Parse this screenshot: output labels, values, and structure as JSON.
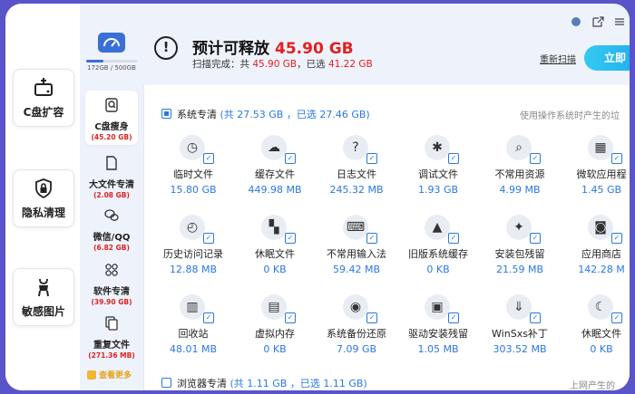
{
  "promo": [
    {
      "label": "C盘扩容",
      "icon": "hard-drive-plus-icon"
    },
    {
      "label": "隐私清理",
      "icon": "lock-icon"
    },
    {
      "label": "敏感图片",
      "icon": "figure-image-icon"
    }
  ],
  "disk": {
    "usage": "172GB / 500GB",
    "fill_fraction": 0.34
  },
  "nav": [
    {
      "name": "C盘瘦身",
      "size": "(45.20 GB)",
      "icon": "search-doc-icon"
    },
    {
      "name": "大文件专清",
      "size": "(2.08 GB)",
      "icon": "file-icon"
    },
    {
      "name": "微信/QQ",
      "size": "(6.82 GB)",
      "icon": "chat-icon"
    },
    {
      "name": "软件专清",
      "size": "(39.90 GB)",
      "icon": "apps-icon"
    },
    {
      "name": "重复文件",
      "size": "(271.36 MB)",
      "icon": "duplicate-icon"
    }
  ],
  "more_label": "查看更多",
  "header": {
    "title": "预计可释放",
    "amount": "45.90 GB",
    "sub_prefix": "扫描完成：共",
    "sub_total": "45.90 GB",
    "sub_mid": "，已选",
    "sub_selected": "41.22 GB",
    "rescan": "重新扫描",
    "cta": "立即"
  },
  "section1": {
    "title": "系统专清",
    "count": "(共 27.53 GB ，已选 27.46 GB)",
    "hint": "使用操作系统时产生的垃"
  },
  "items": [
    {
      "name": "临时文件",
      "size": "15.80 GB",
      "icon": "clipboard-clock-icon"
    },
    {
      "name": "缓存文件",
      "size": "449.98 MB",
      "icon": "cloud-download-icon"
    },
    {
      "name": "日志文件",
      "size": "245.32 MB",
      "icon": "log-question-icon"
    },
    {
      "name": "调试文件",
      "size": "1.93 GB",
      "icon": "bug-icon"
    },
    {
      "name": "不常用资源",
      "size": "4.99 MB",
      "icon": "doc-search-icon"
    },
    {
      "name": "微软应用程",
      "size": "1.45 GB",
      "icon": "windows-icon"
    },
    {
      "name": "历史访问记录",
      "size": "12.88 MB",
      "icon": "history-icon"
    },
    {
      "name": "休眠文件",
      "size": "0 KB",
      "icon": "grid-icon"
    },
    {
      "name": "不常用输入法",
      "size": "59.42 MB",
      "icon": "keyboard-icon"
    },
    {
      "name": "旧版系统缓存",
      "size": "0 KB",
      "icon": "drive-icon"
    },
    {
      "name": "安装包残留",
      "size": "21.59 MB",
      "icon": "chip-icon"
    },
    {
      "name": "应用商店",
      "size": "142.28 M",
      "icon": "store-bag-icon"
    },
    {
      "name": "回收站",
      "size": "48.01 MB",
      "icon": "trash-icon"
    },
    {
      "name": "虚拟内存",
      "size": "0 KB",
      "icon": "memory-icon"
    },
    {
      "name": "系统备份还原",
      "size": "7.09 GB",
      "icon": "restore-icon"
    },
    {
      "name": "驱动安装残留",
      "size": "1.05 MB",
      "icon": "driver-icon"
    },
    {
      "name": "WinSxs补丁",
      "size": "303.52 MB",
      "icon": "download-arrow-icon"
    },
    {
      "name": "休眠文件",
      "size": "0 KB",
      "icon": "moon-icon"
    }
  ],
  "section2": {
    "title": "浏览器专清",
    "count": "(共 1.11 GB ，已选 1.11 GB)",
    "hint": "上网产生的"
  },
  "colors": {
    "accent": "#2a78e4",
    "red": "#e12020",
    "background": "#5a54c9",
    "cta": "#1aa6ee"
  }
}
